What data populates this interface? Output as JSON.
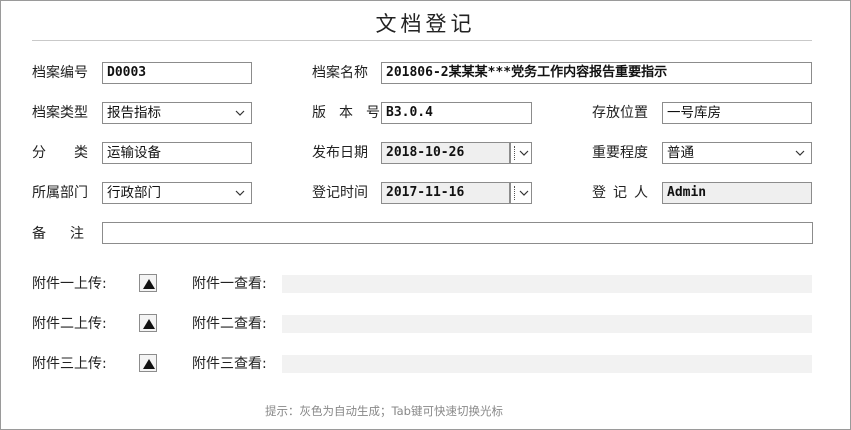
{
  "title": "文档登记",
  "fields": {
    "archive_no": {
      "label": "档案编号",
      "value": "D0003"
    },
    "archive_name": {
      "label": "档案名称",
      "value": "201806-2某某某***党务工作内容报告重要指示"
    },
    "archive_type": {
      "label": "档案类型",
      "value": "报告指标"
    },
    "version": {
      "label": "版本号",
      "value": "B3.0.4"
    },
    "storage": {
      "label": "存放位置",
      "value": "一号库房"
    },
    "category": {
      "label": "分类",
      "value": "运输设备"
    },
    "publish_date": {
      "label": "发布日期",
      "value": "2018-10-26"
    },
    "importance": {
      "label": "重要程度",
      "value": "普通"
    },
    "department": {
      "label": "所属部门",
      "value": "行政部门"
    },
    "register_time": {
      "label": "登记时间",
      "value": "2017-11-16"
    },
    "registrant": {
      "label": "登记人",
      "value": "Admin"
    },
    "remark": {
      "label": "备注",
      "value": ""
    }
  },
  "attachments": [
    {
      "upload_label": "附件一上传:",
      "view_label": "附件一查看:"
    },
    {
      "upload_label": "附件二上传:",
      "view_label": "附件二查看:"
    },
    {
      "upload_label": "附件三上传:",
      "view_label": "附件三查看:"
    }
  ],
  "hint": "提示：灰色为自动生成；Tab键可快速切换光标",
  "icons": {
    "select": "chevron-down-icon",
    "upload": "triangle-up-icon"
  },
  "colors": {
    "readonly_bg": "#efefef",
    "border": "#8c8c8c"
  }
}
